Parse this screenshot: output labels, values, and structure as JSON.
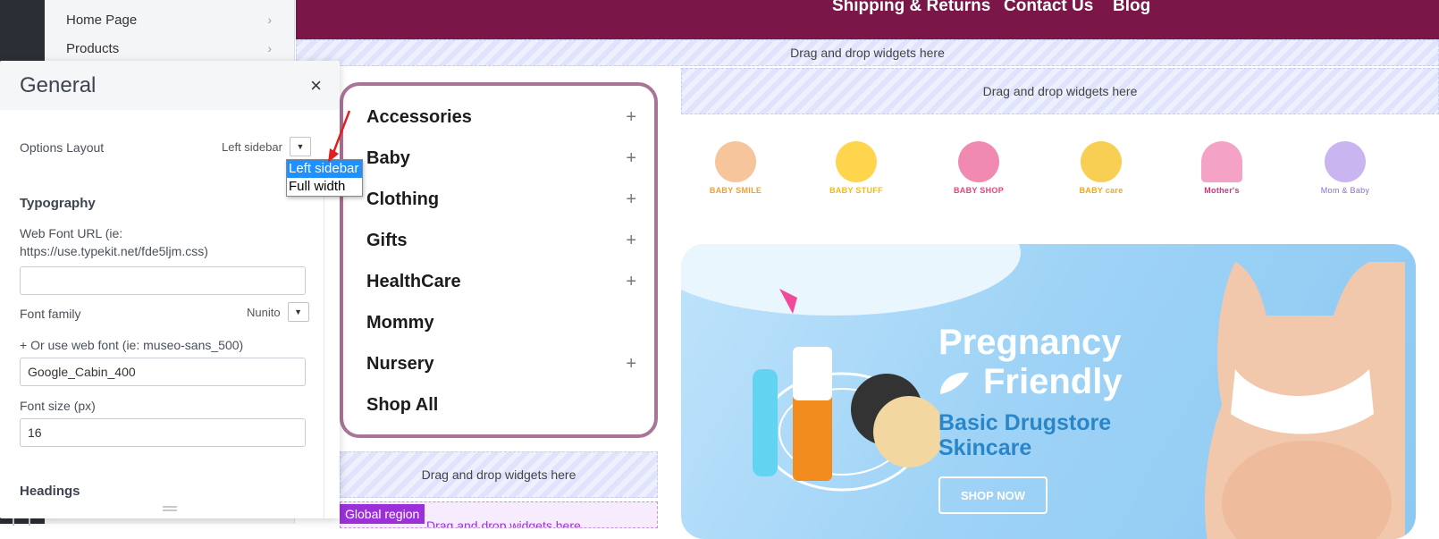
{
  "nav": {
    "items": [
      {
        "label": "Home Page",
        "chevron": "›"
      },
      {
        "label": "Products",
        "chevron": "›"
      }
    ]
  },
  "settings": {
    "title": "General",
    "close_icon": "×",
    "options_layout": {
      "label": "Options Layout",
      "value": "Left sidebar",
      "caret": "▼"
    },
    "dropdown_options": [
      "Left sidebar",
      "Full width"
    ],
    "typography_title": "Typography",
    "web_font_url": {
      "label": "Web Font URL (ie: https://use.typekit.net/fde5ljm.css)",
      "value": ""
    },
    "font_family": {
      "label": "Font family",
      "value": "Nunito",
      "caret": "▼"
    },
    "web_font": {
      "label": "+ Or use web font (ie: museo-sans_500)",
      "value": "Google_Cabin_400"
    },
    "font_size": {
      "label": "Font size (px)",
      "value": "16"
    },
    "headings_title": "Headings"
  },
  "store": {
    "top_nav": [
      "Shipping & Returns",
      "Contact Us",
      "Blog"
    ],
    "dropzone_text": "Drag and drop widgets here",
    "categories": [
      {
        "label": "Accessories",
        "toggle": "+"
      },
      {
        "label": "Baby",
        "toggle": "+"
      },
      {
        "label": "Clothing",
        "toggle": "+"
      },
      {
        "label": "Gifts",
        "toggle": "+"
      },
      {
        "label": "HealthCare",
        "toggle": "+"
      },
      {
        "label": "Mommy",
        "toggle": ""
      },
      {
        "label": "Nursery",
        "toggle": "+"
      },
      {
        "label": "Shop All",
        "toggle": ""
      }
    ],
    "global_region_label": "Global region",
    "brands": [
      {
        "name": "BABY SMILE",
        "color": "#e8a23a"
      },
      {
        "name": "BABY STUFF",
        "color": "#f5b81c"
      },
      {
        "name": "BABY SHOP",
        "color": "#e0457b"
      },
      {
        "name": "BABY care",
        "color": "#f0a81a"
      },
      {
        "name": "Mother's",
        "color": "#d9307a"
      },
      {
        "name": "Mom & Baby",
        "color": "#8e6bd6"
      }
    ],
    "banner": {
      "headline_1": "Pregnancy",
      "headline_2": "Friendly",
      "sub_1": "Basic Drugstore",
      "sub_2": "Skincare",
      "cta": "SHOP NOW"
    }
  },
  "colors": {
    "topbar": "#7a1748",
    "category_border": "#a97596",
    "global_region": "#9b30d9",
    "dropdown_selected": "#1e90ff"
  }
}
